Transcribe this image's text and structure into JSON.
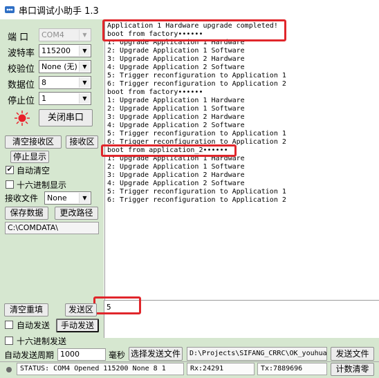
{
  "window": {
    "title": "串口调试小助手 1.3"
  },
  "settings": {
    "port_label": "端  口",
    "port_value": "COM4",
    "baud_label": "波特率",
    "baud_value": "115200",
    "parity_label": "校验位",
    "parity_value": "None (无)",
    "databits_label": "数据位",
    "databits_value": "8",
    "stopbits_label": "停止位",
    "stopbits_value": "1",
    "close_port_button": "关闭串口"
  },
  "receive_controls": {
    "clear_receive_button": "清空接收区",
    "receive_area_button": "接收区",
    "stop_display_button": "停止显示",
    "auto_clear_label": "自动清空",
    "auto_clear_checked": true,
    "hex_display_label": "十六进制显示",
    "hex_display_checked": false,
    "receive_file_label": "接收文件",
    "receive_file_value": "None",
    "save_data_button": "保存数据",
    "change_path_button": "更改路径",
    "path_value": "C:\\COMDATA\\"
  },
  "receive_text": [
    "Application 1 Hardware upgrade completed!",
    "boot from factory••••••",
    "1: Upgrade Application 1 Hardware",
    "2: Upgrade Application 1 Software",
    "3: Upgrade Application 2 Hardware",
    "4: Upgrade Application 2 Software",
    "5: Trigger reconfiguration to Application 1",
    "6: Trigger reconfiguration to Application 2",
    "boot from factory••••••",
    "1: Upgrade Application 1 Hardware",
    "2: Upgrade Application 1 Software",
    "3: Upgrade Application 2 Hardware",
    "4: Upgrade Application 2 Software",
    "5: Trigger reconfiguration to Application 1",
    "6: Trigger reconfiguration to Application 2",
    "boot from application_2••••••",
    "1: Upgrade Application 1 Hardware",
    "2: Upgrade Application 1 Software",
    "3: Upgrade Application 2 Hardware",
    "4: Upgrade Application 2 Software",
    "5: Trigger reconfiguration to Application 1",
    "6: Trigger reconfiguration to Application 2"
  ],
  "send_controls": {
    "clear_resend_button": "清空重填",
    "send_area_button": "发送区",
    "send_text": "5",
    "auto_send_label": "自动发送",
    "auto_send_checked": false,
    "manual_send_button": "手动发送",
    "hex_send_label": "十六进制发送",
    "hex_send_checked": false,
    "auto_send_period_label": "自动发送周期",
    "auto_send_period_value": "1000",
    "ms_label": "毫秒",
    "select_send_file_button": "选择发送文件",
    "send_file_path": "D:\\Projects\\SIFANG_CRRC\\OK_youhua",
    "send_file_button": "发送文件",
    "clear_count_button": "计数清零"
  },
  "status_bar": {
    "status_text": "STATUS: COM4 Opened 115200 None  8 1",
    "rx_text": "Rx:24291",
    "tx_text": "Tx:7889696"
  },
  "colors": {
    "panel_bg": "#d6e7d0",
    "highlight": "#e0262b",
    "port_led": "#e8202a"
  }
}
